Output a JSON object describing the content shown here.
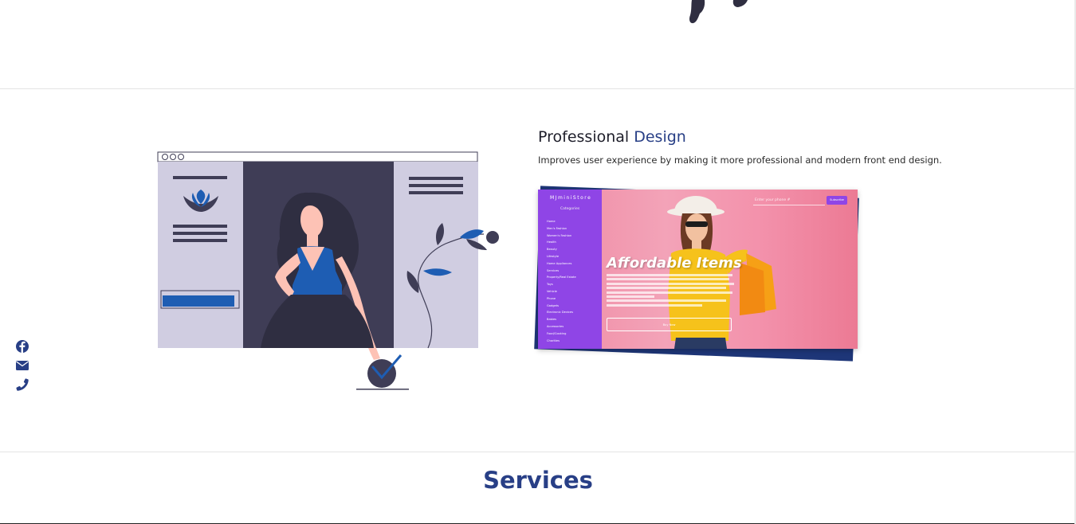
{
  "feature": {
    "title_plain": "Professional ",
    "title_accent": "Design",
    "description": "Improves user experience by making it more professional and modern front end design."
  },
  "screenshot_preview": {
    "brand": "MJminiStore",
    "categories_label": "Categories",
    "category_items": [
      "Home",
      "Men's Fashion",
      "Women's Fashion",
      "Health",
      "Beauty",
      "Lifestyle",
      "Home Appliances",
      "Services",
      "Property/Real Estate",
      "Toys",
      "Vehicle",
      "Phone",
      "Gadgets",
      "Electronic Devices",
      "Babies",
      "Accessories",
      "Food/Cooking",
      "Charities"
    ],
    "hero_heading": "Affordable Items",
    "search_placeholder": "Enter your phone #",
    "subscribe_label": "Subscribe",
    "button_label": "Buy Now"
  },
  "social": {
    "icons": [
      "facebook-icon",
      "envelope-icon",
      "phone-icon"
    ]
  },
  "services": {
    "title": "Services"
  },
  "colors": {
    "accent": "#283f86",
    "illustration_blue": "#1e5db3",
    "illustration_dark": "#3f3d56",
    "panel": "#d0cde1",
    "preview_sidebar": "#8f45e6"
  }
}
